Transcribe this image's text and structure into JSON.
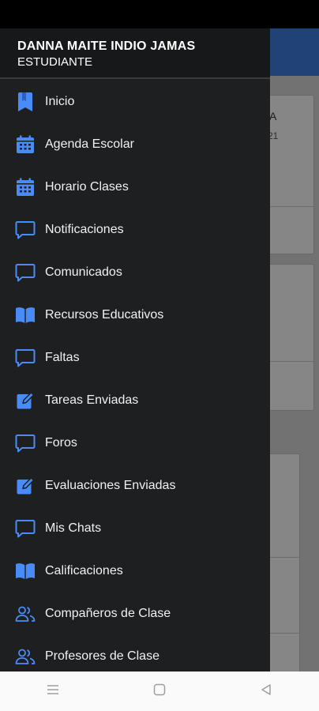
{
  "user": {
    "name": "DANNA MAITE INDIO JAMAS",
    "role": "ESTUDIANTE"
  },
  "menu": [
    {
      "label": "Inicio",
      "icon": "bookmark-icon"
    },
    {
      "label": "Agenda Escolar",
      "icon": "calendar-icon"
    },
    {
      "label": "Horario Clases",
      "icon": "calendar-icon"
    },
    {
      "label": "Notificaciones",
      "icon": "chat-bubble-icon"
    },
    {
      "label": "Comunicados",
      "icon": "chat-bubble-icon"
    },
    {
      "label": "Recursos Educativos",
      "icon": "open-book-icon"
    },
    {
      "label": "Faltas",
      "icon": "chat-bubble-icon"
    },
    {
      "label": "Tareas Enviadas",
      "icon": "edit-square-icon"
    },
    {
      "label": "Foros",
      "icon": "chat-bubble-icon"
    },
    {
      "label": "Evaluaciones Enviadas",
      "icon": "edit-square-icon"
    },
    {
      "label": "Mis Chats",
      "icon": "chat-bubble-icon"
    },
    {
      "label": "Calificaciones",
      "icon": "open-book-icon"
    },
    {
      "label": "Compañeros de Clase",
      "icon": "group-icon"
    },
    {
      "label": "Profesores de Clase",
      "icon": "group-icon"
    }
  ],
  "background": {
    "card_text_1": "A",
    "card_text_2": "21"
  },
  "colors": {
    "accent": "#3d79d8",
    "icon": "#4a8cf7",
    "drawer_bg": "#1e1f20"
  }
}
